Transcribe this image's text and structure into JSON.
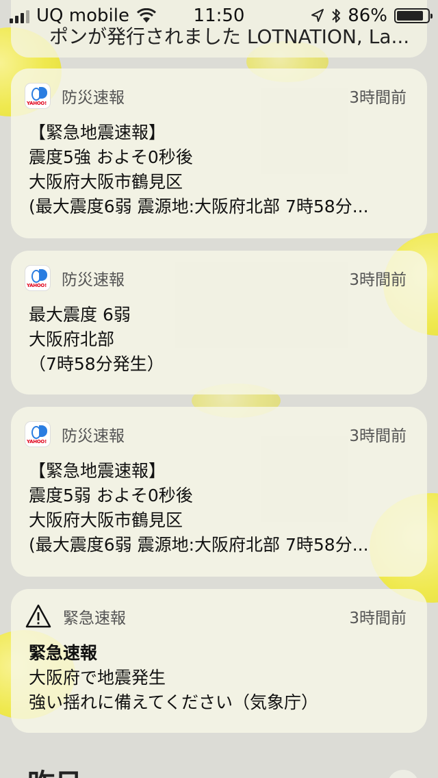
{
  "status_bar": {
    "carrier": "UQ mobile",
    "time": "11:50",
    "battery_percent": "86%",
    "battery_level": 0.86
  },
  "partial_notification": {
    "text": "ポンが発行されました LOTNATION, La..."
  },
  "notifications": [
    {
      "app": "防災速報",
      "time": "3時間前",
      "lines": [
        "【緊急地震速報】",
        "震度5強 およそ0秒後",
        "大阪府大阪市鶴見区",
        "(最大震度6弱 震源地:大阪府北部 7時58分..."
      ]
    },
    {
      "app": "防災速報",
      "time": "3時間前",
      "lines": [
        "最大震度 6弱",
        "大阪府北部",
        "（7時58分発生）"
      ]
    },
    {
      "app": "防災速報",
      "time": "3時間前",
      "lines": [
        "【緊急地震速報】",
        "震度5弱 およそ0秒後",
        "大阪府大阪市鶴見区",
        "(最大震度6弱 震源地:大阪府北部 7時58分..."
      ]
    },
    {
      "app": "緊急速報",
      "time": "3時間前",
      "title": "緊急速報",
      "lines": [
        "大阪府で地震発生",
        "強い揺れに備えてください（気象庁）"
      ]
    }
  ],
  "section_header": "昨日",
  "icons": {
    "signal": "cellular-signal-icon",
    "wifi": "wifi-icon",
    "location": "location-arrow-icon",
    "bluetooth": "bluetooth-icon",
    "battery": "battery-icon",
    "app": "yahoo-bousai-app-icon",
    "warning": "warning-triangle-icon"
  }
}
